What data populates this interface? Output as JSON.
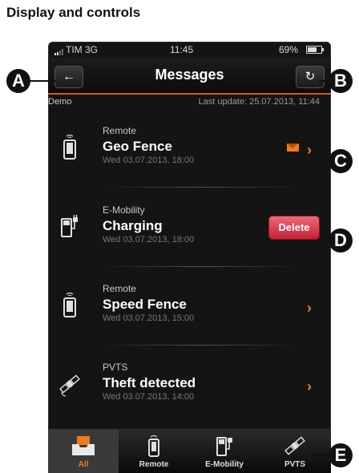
{
  "page": {
    "heading": "Display and controls"
  },
  "status_bar": {
    "carrier": "TIM 3G",
    "time": "11:45",
    "battery_text": "69%",
    "battery_level": 0.69
  },
  "nav": {
    "back_icon": "arrow-left-icon",
    "title": "Messages",
    "refresh_icon": "refresh-icon"
  },
  "subbar": {
    "account": "Demo",
    "last_update": "Last update: 25.07.2013, 11:44"
  },
  "messages": [
    {
      "category": "Remote",
      "title": "Geo Fence",
      "date": "Wed 03.07.2013, 18:00",
      "icon": "phone-icon"
    },
    {
      "category": "E-Mobility",
      "title": "Charging",
      "date": "Wed 03.07.2013, 18:00",
      "icon": "charger-icon"
    },
    {
      "category": "Remote",
      "title": "Speed Fence",
      "date": "Wed 03.07.2013, 15:00",
      "icon": "phone-icon"
    },
    {
      "category": "PVTS",
      "title": "Theft detected",
      "date": "Wed 03.07.2013, 14:00",
      "icon": "satellite-icon"
    }
  ],
  "delete_label": "Delete",
  "tabs": [
    {
      "label": "All",
      "icon": "inbox-icon",
      "active": true
    },
    {
      "label": "Remote",
      "icon": "phone-icon"
    },
    {
      "label": "E-Mobility",
      "icon": "charger-icon"
    },
    {
      "label": "PVTS",
      "icon": "satellite-icon"
    }
  ],
  "callouts": [
    "A",
    "B",
    "C",
    "D",
    "E"
  ],
  "colors": {
    "accent": "#f07a20",
    "delete": "#d42a3c",
    "background": "#141414"
  }
}
